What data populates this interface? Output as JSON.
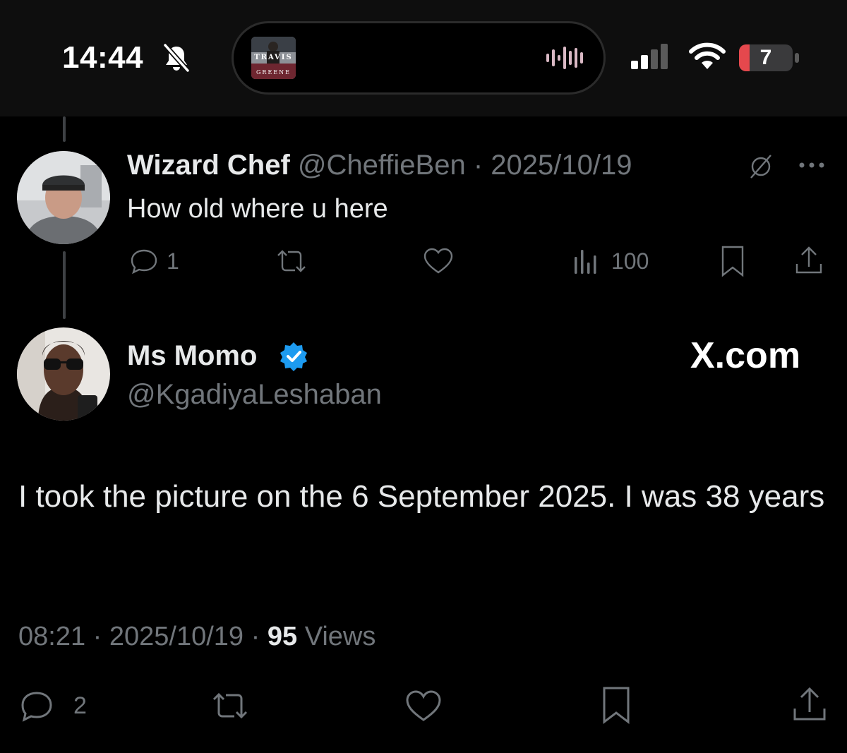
{
  "status_bar": {
    "time": "14:44",
    "now_playing_art": {
      "title": "TRAVIS",
      "subtitle": "GREENE"
    },
    "battery_level": "7",
    "icons": [
      "bell-slash-icon",
      "waveform-icon",
      "cellular-signal-icon",
      "wifi-icon",
      "battery-icon"
    ]
  },
  "reply_tweet": {
    "display_name": "Wizard Chef",
    "handle": "@CheffieBen",
    "separator": "·",
    "date": "2025/10/19",
    "text": "How old where u here",
    "replies": "1",
    "views": "100"
  },
  "main_tweet": {
    "display_name": "Ms Momo",
    "handle": "@KgadiyaLeshaban",
    "watermark": "X.com",
    "text": "I took the picture on the 6 September 2025. I was 38 years",
    "time": "08:21",
    "separator": "·",
    "date": "2025/10/19",
    "view_count": "95",
    "views_label": "Views",
    "replies": "2"
  },
  "colors": {
    "background": "#000000",
    "text": "#e7e9ea",
    "muted": "#71767b",
    "verified": "#1d9bf0",
    "battery_low": "#e5484d"
  }
}
